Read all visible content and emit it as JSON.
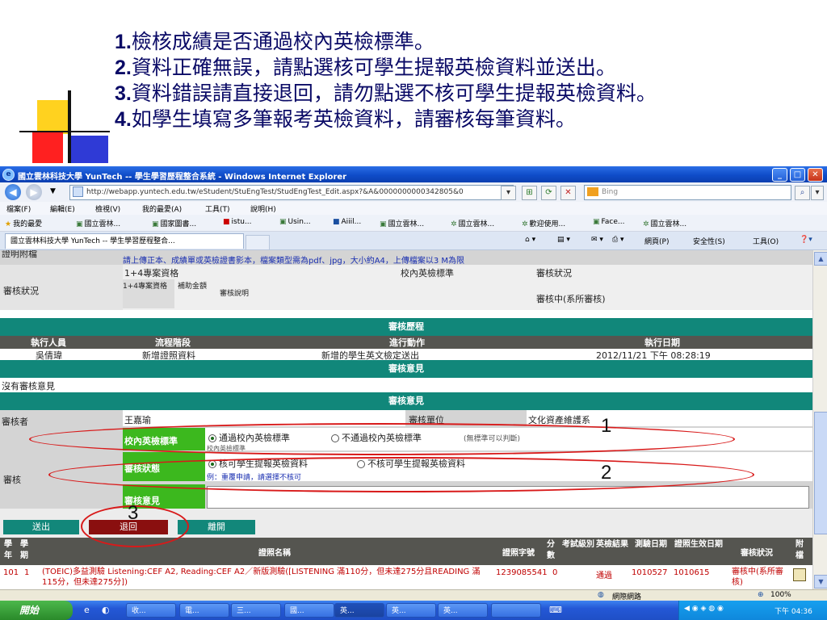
{
  "slide": {
    "instructions": [
      {
        "num": "1.",
        "text": "檢核成績是否通過校內英檢標準。"
      },
      {
        "num": "2.",
        "text": "資料正確無誤，請點選核可學生提報英檢資料並送出。"
      },
      {
        "num": "3.",
        "text": "資料錯誤請直接退回，請勿點選不核可學生提報英檢資料。"
      },
      {
        "num": "4.",
        "text": "如學生填寫多筆報考英檢資料，請審核每筆資料。"
      }
    ],
    "callouts": [
      "1",
      "2",
      "3"
    ]
  },
  "browser": {
    "title": "國立雲林科技大學 YunTech -- 學生學習歷程整合系統 - Windows Internet Explorer",
    "url": "http://webapp.yuntech.edu.tw/eStudent/StuEngTest/StudEngTest_Edit.aspx?&A&0000000000342805&0",
    "search_placeholder": "Bing",
    "menu": [
      "檔案(F)",
      "編輯(E)",
      "檢視(V)",
      "我的最愛(A)",
      "工具(T)",
      "說明(H)"
    ],
    "favorites": [
      "我的最愛",
      "國立雲林...",
      "國家圖書...",
      "istu...",
      "Usin...",
      "Aiiil...",
      "國立雲林...",
      "國立雲林...",
      "歡迎使用...",
      "Face...",
      "國立雲林..."
    ],
    "tab_title": "國立雲林科技大學 YunTech -- 學生學習歷程整合...",
    "command_bar": [
      "網頁(P)",
      "安全性(S)",
      "工具(O)"
    ]
  },
  "page": {
    "top_note": "請上傳正本、成績單或英檢證書影本，檔案類型需為pdf、jpg，大小約A4，上傳檔案以3 M為限",
    "proof_label": "證明附檔",
    "review_status_label": "審核狀況",
    "sub_header": {
      "col1": "1+4專案資格",
      "col2": "校內英檢標準",
      "col3": "審核狀況"
    },
    "sub_cols": {
      "a": "1+4專案資格",
      "b": "補助金額",
      "c": "審核說明"
    },
    "status_value": "審核中(系所審核)",
    "history_title": "審核歷程",
    "history_headers": [
      "執行人員",
      "流程階段",
      "進行動作",
      "執行日期"
    ],
    "history_row": [
      "吳倩瑋",
      "新增證照資料",
      "新增的學生英文檢定送出",
      "2012/11/21 下午 08:28:19"
    ],
    "opinion_title": "審核意見",
    "no_opinion": "沒有審核意見",
    "opinion_title2": "審核意見",
    "reviewer_label": "審核者",
    "reviewer_name": "王嘉瑜",
    "unit_label": "審核單位",
    "unit_value": "文化資產維護系",
    "review_label": "審核",
    "standard_label": "校內英檢標準",
    "standard_options": [
      "通過校內英檢標準",
      "不通過校內英檢標準"
    ],
    "standard_note": "(無標準可以判斷)",
    "standard_sub": "校內英檢標準",
    "status_label": "審核狀態",
    "status_options": [
      "核可學生提報英檢資料",
      "不核可學生提報英檢資料"
    ],
    "status_example": "例：重覆申請，請選擇不核可",
    "opinion_label": "審核意見",
    "buttons": {
      "submit": "送出",
      "return": "退回",
      "leave": "離開"
    },
    "table_headers": [
      "學年",
      "學期",
      "證照名稱",
      "證照字號",
      "分數",
      "考試級別",
      "英檢結果",
      "測驗日期",
      "證照生效日期",
      "審核狀況",
      "附檔"
    ],
    "table_row": {
      "year": "101",
      "term": "1",
      "name": "(TOEIC)多益測驗 Listening:CEF A2, Reading:CEF A2／新版測驗([LISTENING 滿110分，但未達275分且READING 滿115分，但未達275分])",
      "cert_no": "1239085541",
      "score": "0",
      "level": "",
      "result": "通過",
      "test_date": "1010527",
      "effective": "1010615",
      "status": "審核中(系所審核)"
    }
  },
  "statusbar": {
    "zone": "網際網路",
    "zoom": "100%"
  },
  "taskbar": {
    "start": "開始",
    "buttons": [
      "收...",
      "電...",
      "三...",
      "國...",
      "英...",
      "英...",
      "英..."
    ],
    "clock": "下午 04:36"
  }
}
